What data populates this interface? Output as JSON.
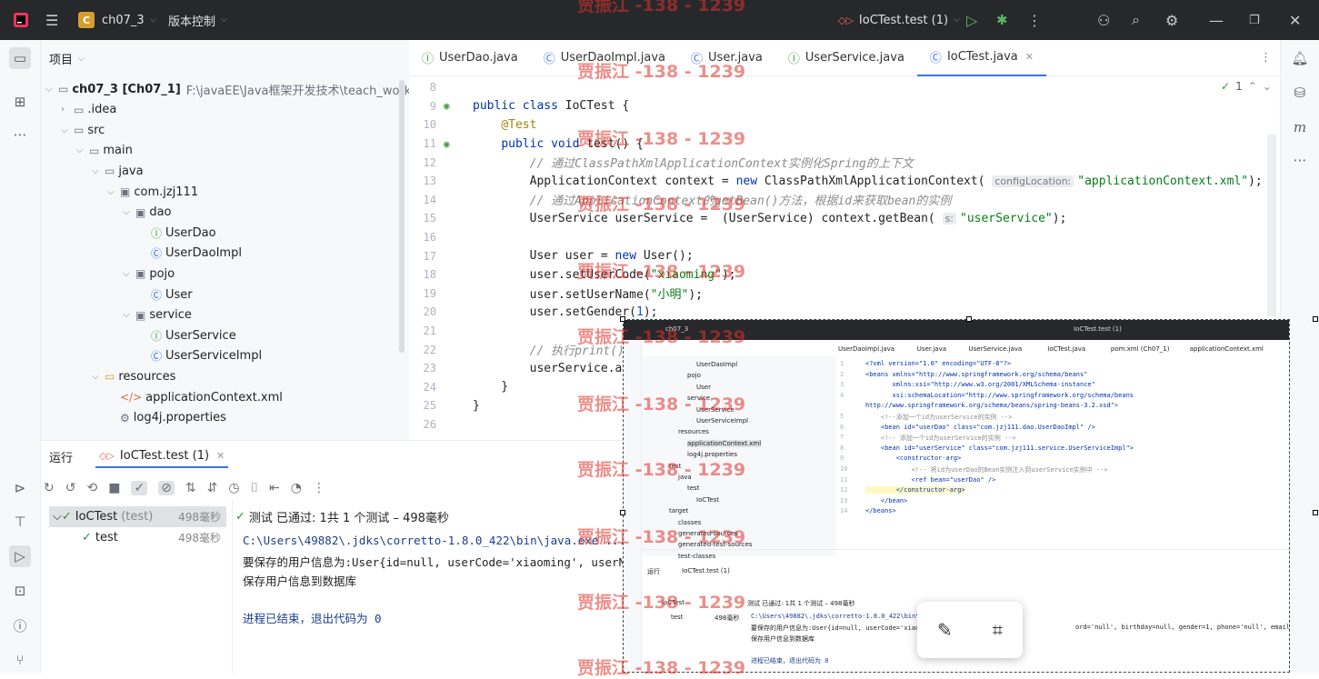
{
  "titlebar": {
    "project_badge": "C",
    "project_name": "ch07_3",
    "vcs": "版本控制",
    "run_config": "IoCTest.test (1)"
  },
  "project_panel": {
    "title": "项目",
    "tree": [
      {
        "label": "ch07_3 [Ch07_1]",
        "extra": "F:\\javaEE\\Java框架开发技术\\teach_workspace",
        "indent": 0,
        "icon": "module-icon"
      },
      {
        "label": ".idea",
        "indent": 1,
        "icon": "folder-icon"
      },
      {
        "label": "src",
        "indent": 1,
        "icon": "folder-icon"
      },
      {
        "label": "main",
        "indent": 2,
        "icon": "folder-icon"
      },
      {
        "label": "java",
        "indent": 3,
        "icon": "folder-icon"
      },
      {
        "label": "com.jzj111",
        "indent": 4,
        "icon": "package-icon"
      },
      {
        "label": "dao",
        "indent": 5,
        "icon": "package-icon"
      },
      {
        "label": "UserDao",
        "indent": 6,
        "icon": "interface-icon"
      },
      {
        "label": "UserDaoImpl",
        "indent": 6,
        "icon": "class-icon"
      },
      {
        "label": "pojo",
        "indent": 5,
        "icon": "package-icon"
      },
      {
        "label": "User",
        "indent": 6,
        "icon": "class-icon"
      },
      {
        "label": "service",
        "indent": 5,
        "icon": "package-icon"
      },
      {
        "label": "UserService",
        "indent": 6,
        "icon": "interface-icon"
      },
      {
        "label": "UserServiceImpl",
        "indent": 6,
        "icon": "class-icon"
      },
      {
        "label": "resources",
        "indent": 3,
        "icon": "resources-folder-icon"
      },
      {
        "label": "applicationContext.xml",
        "indent": 4,
        "icon": "xml-icon"
      },
      {
        "label": "log4j.properties",
        "indent": 4,
        "icon": "properties-icon"
      }
    ]
  },
  "editor": {
    "tabs": [
      {
        "label": "UserDao.java",
        "icon": "interface-icon"
      },
      {
        "label": "UserDaoImpl.java",
        "icon": "class-icon"
      },
      {
        "label": "User.java",
        "icon": "class-icon"
      },
      {
        "label": "UserService.java",
        "icon": "interface-icon"
      },
      {
        "label": "IoCTest.java",
        "icon": "class-icon",
        "active": true
      }
    ],
    "inspection_count": "1",
    "lines": [
      {
        "n": "8",
        "html": ""
      },
      {
        "n": "9",
        "html": "<span class='kw'>public class </span>IoCTest {"
      },
      {
        "n": "10",
        "html": "    <span class='ann'>@Test</span>"
      },
      {
        "n": "11",
        "html": "    <span class='kw'>public void </span>test() {"
      },
      {
        "n": "12",
        "html": "        <span class='cm'>// 通过ClassPathXmlApplicationContext实例化Spring的上下文</span>"
      },
      {
        "n": "13",
        "html": "        ApplicationContext context = <span class='kw'>new </span>ClassPathXmlApplicationContext( <span class='hint'>configLocation:</span><span class='str'>\"applicationContext.xml\"</span>);"
      },
      {
        "n": "14",
        "html": "        <span class='cm'>// 通过ApplicationContext的getBean()方法，根据id来获取bean的实例</span>"
      },
      {
        "n": "15",
        "html": "        UserService userService =  (UserService) context.getBean( <span class='hint'>s:</span><span class='str'>\"userService\"</span>);"
      },
      {
        "n": "16",
        "html": ""
      },
      {
        "n": "17",
        "html": "        User user = <span class='kw'>new </span>User();"
      },
      {
        "n": "18",
        "html": "        user.setUserCode(<span class='str'>\"xiaoming\"</span>);"
      },
      {
        "n": "19",
        "html": "        user.setUserName(<span class='str'>\"小明\"</span>);"
      },
      {
        "n": "20",
        "html": "        user.setGender(<span class='num'>1</span>);"
      },
      {
        "n": "21",
        "html": ""
      },
      {
        "n": "22",
        "html": "        <span class='cm'>// 执行print()</span>"
      },
      {
        "n": "23",
        "html": "        userService.ad"
      },
      {
        "n": "24",
        "html": "    }"
      },
      {
        "n": "25",
        "html": "}"
      },
      {
        "n": "26",
        "html": ""
      }
    ]
  },
  "run": {
    "title": "运行",
    "tab": "IoCTest.test (1)",
    "tests": [
      {
        "name": "IoCTest",
        "suffix": "(test)",
        "time": "498毫秒"
      },
      {
        "name": "test",
        "suffix": "",
        "time": "498毫秒"
      }
    ],
    "status": "测试 已通过: 1共 1 个测试 – 498毫秒",
    "console": [
      "C:\\Users\\49882\\.jdks\\corretto-1.8.0_422\\bin\\java.exe ...",
      "要保存的用户信息为:User{id=null, userCode='xiaoming', userN",
      "保存用户信息到数据库",
      "",
      "进程已结束，退出代码为 0"
    ]
  },
  "overlay": {
    "title": "ch07_3",
    "run_config": "IoCTest.test (1)",
    "tabs": [
      "UserDaoImpl.java",
      "User.java",
      "UserService.java",
      "IoCTest.java",
      "pom.xml (Ch07_1)",
      "applicationContext.xml"
    ],
    "tree": [
      "UserDaoImpl",
      "pojo",
      "User",
      "service",
      "UserService",
      "UserServiceImpl",
      "resources",
      "applicationContext.xml",
      "log4j.properties",
      "test",
      "java",
      "test",
      "IoCTest",
      "target",
      "classes",
      "generated-sources",
      "generated-test-sources",
      "test-classes"
    ],
    "code": [
      {
        "n": "1",
        "t": "<?xml version=\"1.0\" encoding=\"UTF-8\"?>"
      },
      {
        "n": "2",
        "t": "<beans xmlns=\"http://www.springframework.org/schema/beans\""
      },
      {
        "n": "3",
        "t": "       xmlns:xsi=\"http://www.w3.org/2001/XMLSchema-instance\""
      },
      {
        "n": "4",
        "t": "       xsi:schemaLocation=\"http://www.springframework.org/schema/beans"
      },
      {
        "n": "",
        "t": "http://www.springframework.org/schema/beans/spring-beans-3.2.xsd\">"
      },
      {
        "n": "5",
        "t": "    <!--添加一个id为userService的实例 -->"
      },
      {
        "n": "6",
        "t": "    <bean id=\"userDao\" class=\"com.jzj111.dao.UserDaoImpl\" />"
      },
      {
        "n": "7",
        "t": "    <!-- 添加一个id为userService的实例 -->"
      },
      {
        "n": "8",
        "t": "    <bean id=\"userService\" class=\"com.jzj111.service.UserServiceImpl\">"
      },
      {
        "n": "9",
        "t": "        <constructor-arg>"
      },
      {
        "n": "10",
        "t": "            <!-- 将id为userDao的Bean实例注入到userService实例中 -->"
      },
      {
        "n": "11",
        "t": "            <ref bean=\"userDao\" />"
      },
      {
        "n": "12",
        "t": "        </constructor-arg>"
      },
      {
        "n": "13",
        "t": "    </bean>"
      },
      {
        "n": "14",
        "t": "</beans>"
      }
    ],
    "run_title": "运行",
    "run_tab": "IoCTest.test (1)",
    "status": "测试 已通过: 1共 1 个测试 – 498毫秒",
    "tests": [
      "IoCTest",
      "test"
    ],
    "test_time": "498毫秒",
    "console": [
      "C:\\Users\\49882\\.jdks\\corretto-1.8.0_422\\bin\\ja",
      "要保存的用户信息为:User{id=null, userCode='xiaomin",
      "保存用户信息到数据库",
      "",
      "进程已结束，退出代码为 0"
    ],
    "console_tail": "ord='null', birthday=null, gender=1, phone='null', email='null', address"
  },
  "watermark": "贾振江 -138 - 1239"
}
